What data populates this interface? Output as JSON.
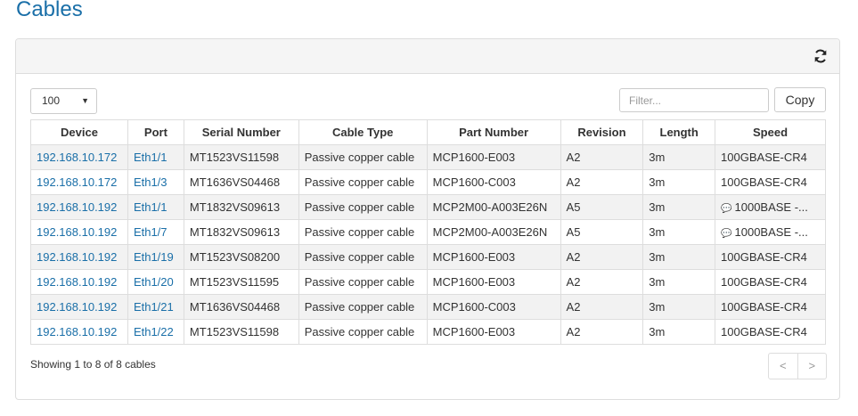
{
  "page": {
    "title": "Cables"
  },
  "toolbar": {
    "length_value": "100",
    "filter_placeholder": "Filter...",
    "copy_label": "Copy"
  },
  "table": {
    "columns": [
      "Device",
      "Port",
      "Serial Number",
      "Cable Type",
      "Part Number",
      "Revision",
      "Length",
      "Speed"
    ],
    "rows": [
      {
        "device": "192.168.10.172",
        "port": "Eth1/1",
        "serial": "MT1523VS11598",
        "cable_type": "Passive copper cable",
        "part": "MCP1600-E003",
        "revision": "A2",
        "length": "3m",
        "speed": "100GBASE-CR4",
        "speed_icon": false
      },
      {
        "device": "192.168.10.172",
        "port": "Eth1/3",
        "serial": "MT1636VS04468",
        "cable_type": "Passive copper cable",
        "part": "MCP1600-C003",
        "revision": "A2",
        "length": "3m",
        "speed": "100GBASE-CR4",
        "speed_icon": false
      },
      {
        "device": "192.168.10.192",
        "port": "Eth1/1",
        "serial": "MT1832VS09613",
        "cable_type": "Passive copper cable",
        "part": "MCP2M00-A003E26N",
        "revision": "A5",
        "length": "3m",
        "speed": "1000BASE -...",
        "speed_icon": true
      },
      {
        "device": "192.168.10.192",
        "port": "Eth1/7",
        "serial": "MT1832VS09613",
        "cable_type": "Passive copper cable",
        "part": "MCP2M00-A003E26N",
        "revision": "A5",
        "length": "3m",
        "speed": "1000BASE -...",
        "speed_icon": true
      },
      {
        "device": "192.168.10.192",
        "port": "Eth1/19",
        "serial": "MT1523VS08200",
        "cable_type": "Passive copper cable",
        "part": "MCP1600-E003",
        "revision": "A2",
        "length": "3m",
        "speed": "100GBASE-CR4",
        "speed_icon": false
      },
      {
        "device": "192.168.10.192",
        "port": "Eth1/20",
        "serial": "MT1523VS11595",
        "cable_type": "Passive copper cable",
        "part": "MCP1600-E003",
        "revision": "A2",
        "length": "3m",
        "speed": "100GBASE-CR4",
        "speed_icon": false
      },
      {
        "device": "192.168.10.192",
        "port": "Eth1/21",
        "serial": "MT1636VS04468",
        "cable_type": "Passive copper cable",
        "part": "MCP1600-C003",
        "revision": "A2",
        "length": "3m",
        "speed": "100GBASE-CR4",
        "speed_icon": false
      },
      {
        "device": "192.168.10.192",
        "port": "Eth1/22",
        "serial": "MT1523VS11598",
        "cable_type": "Passive copper cable",
        "part": "MCP1600-E003",
        "revision": "A2",
        "length": "3m",
        "speed": "100GBASE-CR4",
        "speed_icon": false
      }
    ]
  },
  "footer": {
    "info": "Showing 1 to 8 of 8 cables",
    "prev_label": "<",
    "next_label": ">"
  },
  "icons": {
    "refresh": "refresh-icon",
    "speed_note": "comment-icon",
    "select_caret": "caret-down-icon"
  },
  "colors": {
    "title": "#1a6fa8",
    "link": "#1a6fa8",
    "panel_heading": "#f5f5f5",
    "stripe": "#f2f2f2",
    "border": "#dddddd"
  }
}
